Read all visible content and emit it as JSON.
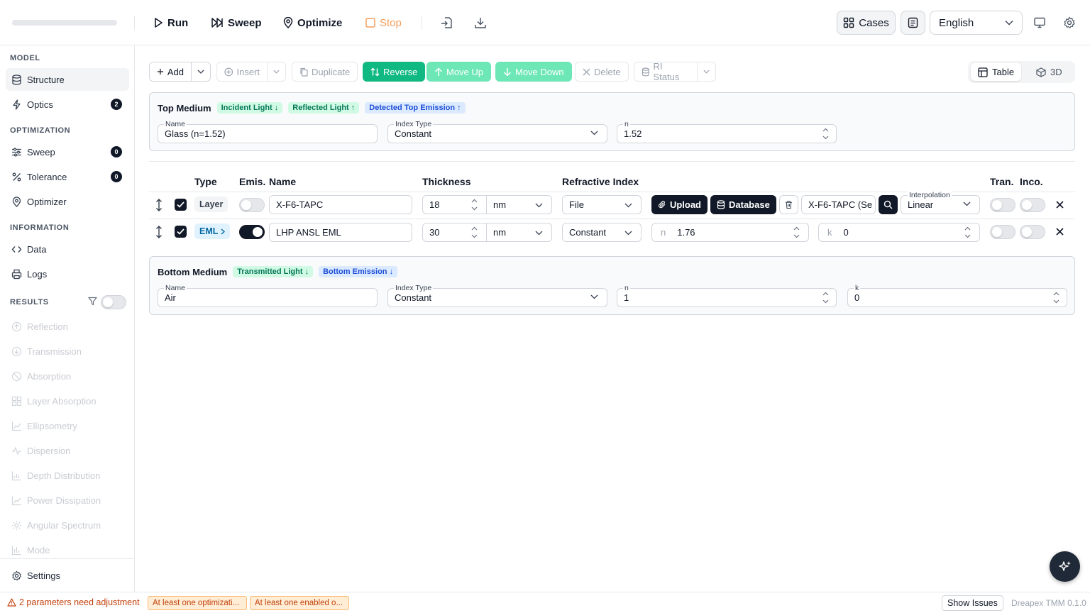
{
  "toolbar": {
    "run": "Run",
    "sweep": "Sweep",
    "optimize": "Optimize",
    "stop": "Stop",
    "cases": "Cases",
    "language": "English"
  },
  "sidebar": {
    "sections": {
      "model": "MODEL",
      "optimization": "OPTIMIZATION",
      "information": "INFORMATION",
      "results": "RESULTS"
    },
    "items": {
      "structure": "Structure",
      "optics": "Optics",
      "optics_badge": "2",
      "sweep": "Sweep",
      "sweep_badge": "0",
      "tolerance": "Tolerance",
      "tolerance_badge": "0",
      "optimizer": "Optimizer",
      "data": "Data",
      "logs": "Logs"
    },
    "results": [
      "Reflection",
      "Transmission",
      "Absorption",
      "Layer Absorption",
      "Ellipsometry",
      "Dispersion",
      "Depth Distribution",
      "Power Dissipation",
      "Angular Spectrum",
      "Mode"
    ],
    "settings": "Settings"
  },
  "actions": {
    "add": "Add",
    "insert": "Insert",
    "duplicate": "Duplicate",
    "reverse": "Reverse",
    "move_up": "Move Up",
    "move_down": "Move Down",
    "delete": "Delete",
    "ri_status": "RI Status",
    "view_table": "Table",
    "view_3d": "3D"
  },
  "top_medium": {
    "title": "Top Medium",
    "tags": [
      "Incident Light ↓",
      "Reflected Light ↑",
      "Detected Top Emission ↑"
    ],
    "name_label": "Name",
    "name": "Glass (n=1.52)",
    "index_type_label": "Index Type",
    "index_type": "Constant",
    "n_label": "n",
    "n": "1.52"
  },
  "columns": {
    "type": "Type",
    "emis": "Emis.",
    "name": "Name",
    "thickness": "Thickness",
    "refractive_index": "Refractive Index",
    "tran": "Tran.",
    "inco": "Inco."
  },
  "layers": [
    {
      "type": "Layer",
      "name": "X-F6-TAPC",
      "thickness": "18",
      "unit": "nm",
      "ri_mode": "File",
      "upload": "Upload",
      "database": "Database",
      "file": "X-F6-TAPC (Se",
      "interp_label": "Interpolation",
      "interp": "Linear"
    },
    {
      "type": "EML",
      "name": "LHP ANSL EML",
      "thickness": "30",
      "unit": "nm",
      "ri_mode": "Constant",
      "n_label": "n",
      "n": "1.76",
      "k_label": "k",
      "k": "0"
    }
  ],
  "bottom_medium": {
    "title": "Bottom Medium",
    "tags": [
      "Transmitted Light ↓",
      "Bottom Emission ↓"
    ],
    "name_label": "Name",
    "name": "Air",
    "index_type_label": "Index Type",
    "index_type": "Constant",
    "n_label": "n",
    "n": "1",
    "k_label": "k",
    "k": "0"
  },
  "status": {
    "warning": "2 parameters need adjustment",
    "pill1": "At least one optimizati...",
    "pill2": "At least one enabled o...",
    "show_issues": "Show Issues",
    "version": "Dreapex TMM 0.1.0"
  },
  "colors": {
    "accent_green": "#10b981",
    "warning_orange": "#c2410c"
  }
}
